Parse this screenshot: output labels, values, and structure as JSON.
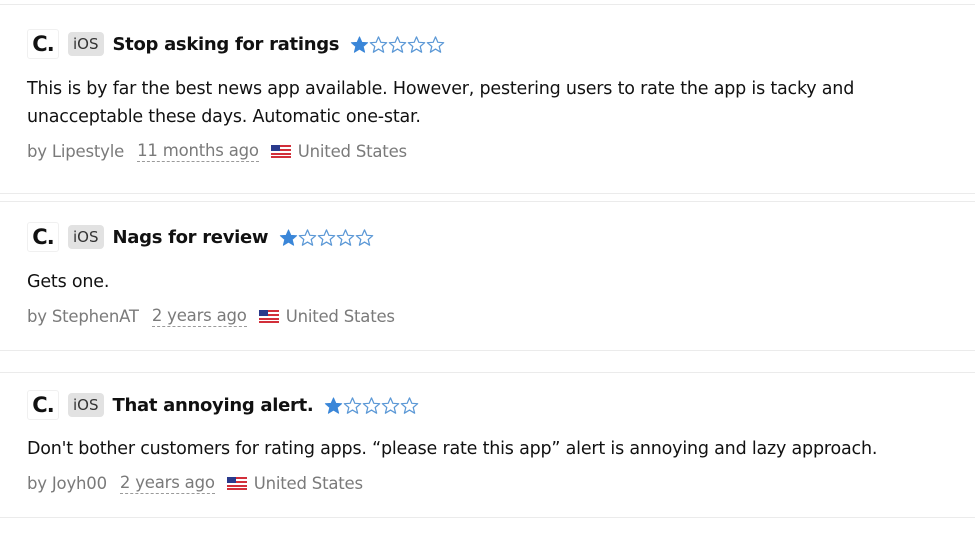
{
  "colors": {
    "star_filled": "#3a86d8",
    "star_empty_stroke": "#5b98d6",
    "meta_text": "#7a7a7a",
    "badge_bg": "#e2e2e2"
  },
  "reviews": [
    {
      "app_logo": "C.",
      "platform": "iOS",
      "title": "Stop asking for ratings",
      "rating": 1,
      "rating_max": 5,
      "body": "This is by far the best news app available. However, pestering users to rate the app is tacky and unacceptable these days. Automatic one-star.",
      "author": "by Lipestyle",
      "date": "11 months ago",
      "country_flag": "us-flag-icon",
      "country": "United States"
    },
    {
      "app_logo": "C.",
      "platform": "iOS",
      "title": "Nags for review",
      "rating": 1,
      "rating_max": 5,
      "body": "Gets one.",
      "author": "by StephenAT",
      "date": "2 years ago",
      "country_flag": "us-flag-icon",
      "country": "United States"
    },
    {
      "app_logo": "C.",
      "platform": "iOS",
      "title": "That annoying alert.",
      "rating": 1,
      "rating_max": 5,
      "body": "Don't bother customers for rating apps. “please rate this app” alert is annoying and lazy approach.",
      "author": "by Joyh00",
      "date": "2 years ago",
      "country_flag": "us-flag-icon",
      "country": "United States"
    }
  ]
}
